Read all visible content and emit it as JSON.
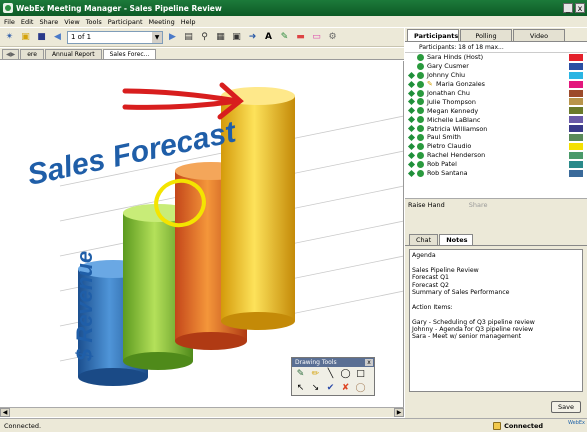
{
  "window": {
    "title": "WebEx Meeting Manager - Sales Pipeline Review",
    "minimize": "_",
    "close": "x"
  },
  "menu": [
    "File",
    "Edit",
    "Share",
    "View",
    "Tools",
    "Participant",
    "Meeting",
    "Help"
  ],
  "toolbar": {
    "page_value": "1 of 1"
  },
  "doc_tabs": [
    "Annual Report",
    "Sales Forec..."
  ],
  "doc_tab_partial": "ere",
  "slide": {
    "title": "Sales Forecast",
    "ylabel": "$ Revenue",
    "bar_colors": [
      "#2f6fb8",
      "#8cc63f",
      "#e8702a",
      "#f2c21b"
    ],
    "bar_heights_fraction": [
      0.3,
      0.53,
      0.72,
      1.0
    ]
  },
  "drawing_tools": {
    "title": "Drawing Tools",
    "close": "x"
  },
  "status": {
    "left": "Connected.",
    "connection": "Connected"
  },
  "logo": "WebEx",
  "right_tabs": {
    "participants": "Participants",
    "polling": "Polling",
    "video": "Video"
  },
  "participants_header": "Participants: 18 of 18 max...",
  "participants": [
    {
      "name": "Sara Hinds (Host)",
      "swatch": "#e4212b",
      "has_diamond": false,
      "pen": false
    },
    {
      "name": "Gary Cusmer",
      "swatch": "#2a4fa3",
      "has_diamond": false,
      "pen": false
    },
    {
      "name": "Johnny Chiu",
      "swatch": "#2ab5e3",
      "has_diamond": true,
      "pen": false
    },
    {
      "name": "Maria Gonzales",
      "swatch": "#e3177d",
      "has_diamond": true,
      "pen": true
    },
    {
      "name": "Jonathan Chu",
      "swatch": "#9c4a2a",
      "has_diamond": true,
      "pen": false
    },
    {
      "name": "Julie Thompson",
      "swatch": "#b8944a",
      "has_diamond": true,
      "pen": false
    },
    {
      "name": "Megan Kennedy",
      "swatch": "#6a7a2a",
      "has_diamond": true,
      "pen": false
    },
    {
      "name": "Michelle LaBlanc",
      "swatch": "#6a5aa8",
      "has_diamond": true,
      "pen": false
    },
    {
      "name": "Patricia Williamson",
      "swatch": "#3a3a8a",
      "has_diamond": true,
      "pen": false
    },
    {
      "name": "Paul Smith",
      "swatch": "#5a8a5a",
      "has_diamond": true,
      "pen": false
    },
    {
      "name": "Pietro Claudio",
      "swatch": "#f4e000",
      "has_diamond": true,
      "pen": false
    },
    {
      "name": "Rachel Henderson",
      "swatch": "#4a9a6a",
      "has_diamond": true,
      "pen": false
    },
    {
      "name": "Rob Patel",
      "swatch": "#2a8a8a",
      "has_diamond": true,
      "pen": false
    },
    {
      "name": "Rob Santana",
      "swatch": "#3a6a9a",
      "has_diamond": true,
      "pen": false
    }
  ],
  "participant_footer": {
    "raise_hand": "Raise Hand",
    "disabled": "Share"
  },
  "notes_tabs": {
    "chat": "Chat",
    "notes": "Notes"
  },
  "notes_text": "Agenda\n\nSales Pipeline Review\nForecast Q1\nForecast Q2\nSummary of Sales Performance\n\nAction Items:\n\nGary - Scheduling of Q3 pipeline review\nJohnny - Agenda for Q3 pipeline review\nSara - Meet w/ senior management",
  "save_label": "Save"
}
